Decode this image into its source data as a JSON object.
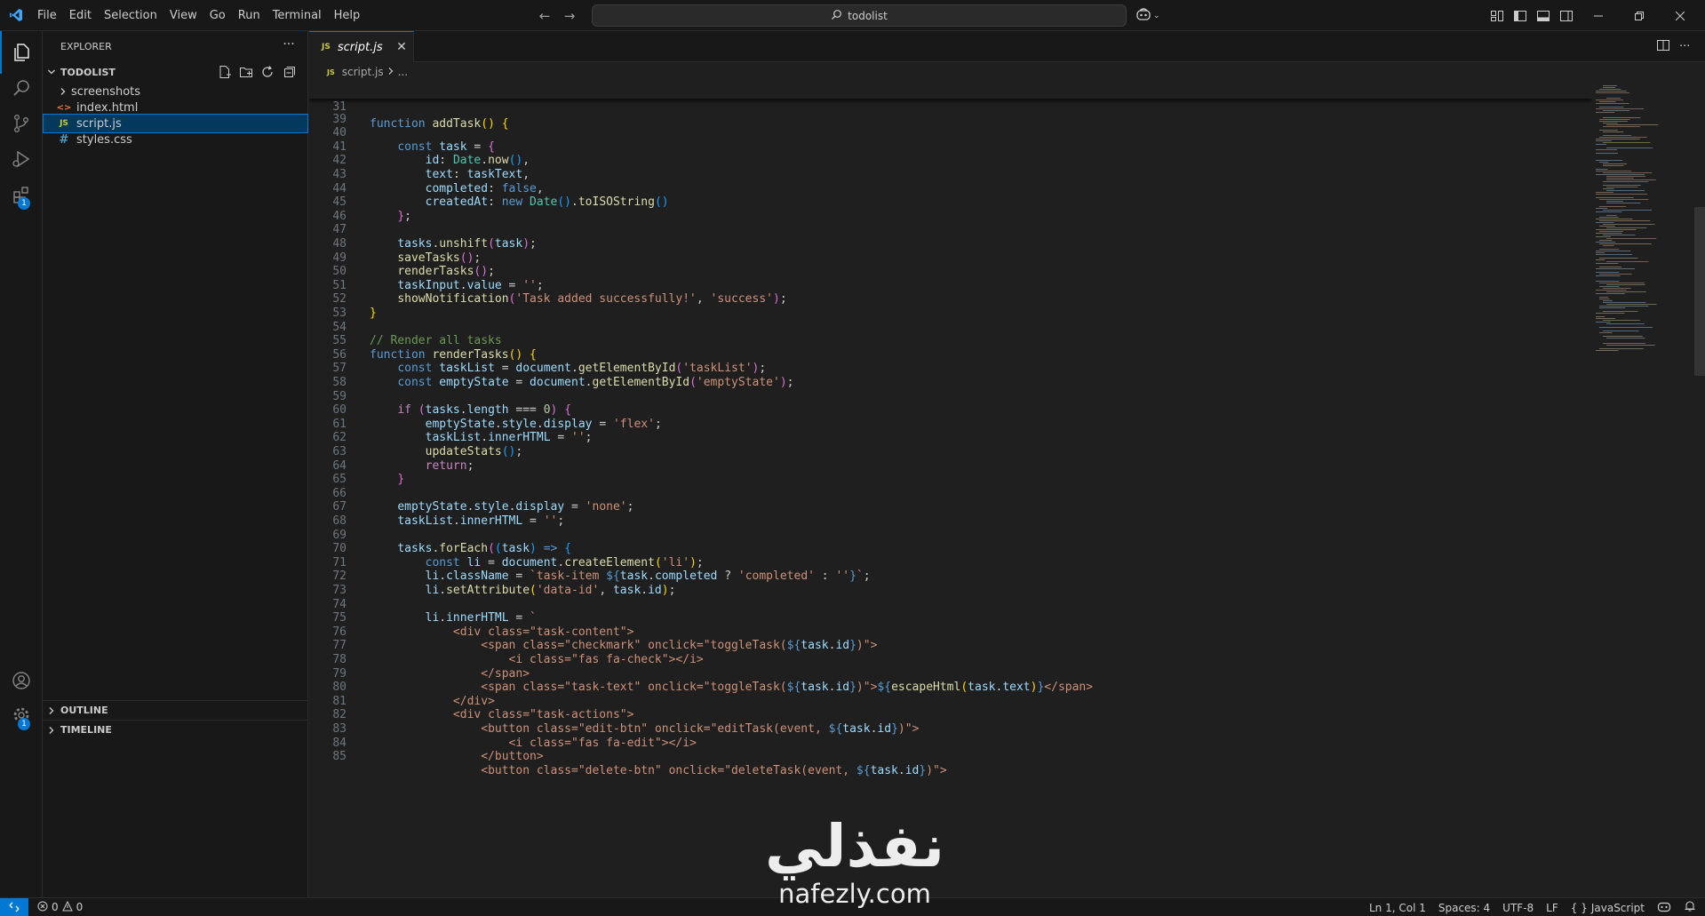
{
  "menu": [
    "File",
    "Edit",
    "Selection",
    "View",
    "Go",
    "Run",
    "Terminal",
    "Help"
  ],
  "command_center": {
    "text": "todolist"
  },
  "sidebar": {
    "title": "EXPLORER",
    "folder": "TODOLIST",
    "items": [
      {
        "name": "screenshots",
        "kind": "folder"
      },
      {
        "name": "index.html",
        "kind": "html"
      },
      {
        "name": "script.js",
        "kind": "js"
      },
      {
        "name": "styles.css",
        "kind": "css"
      }
    ],
    "outline": "OUTLINE",
    "timeline": "TIMELINE"
  },
  "activity": {
    "extensions_badge": "1",
    "settings_badge": "1"
  },
  "tab": {
    "label": "script.js",
    "type": "JS"
  },
  "breadcrumb": {
    "file": "script.js",
    "rest": "..."
  },
  "code": {
    "sticky_line": "31",
    "lines": [
      "39",
      "40",
      "41",
      "42",
      "43",
      "44",
      "45",
      "46",
      "47",
      "48",
      "49",
      "50",
      "51",
      "52",
      "53",
      "54",
      "55",
      "56",
      "57",
      "58",
      "59",
      "60",
      "61",
      "62",
      "63",
      "64",
      "65",
      "66",
      "67",
      "68",
      "69",
      "70",
      "71",
      "72",
      "73",
      "74",
      "75",
      "76",
      "77",
      "78",
      "79",
      "80",
      "81",
      "82",
      "83",
      "84",
      "85"
    ],
    "s": {
      "function": "function",
      "addTask": "addTask",
      "const": "const",
      "task": "task",
      "id": "id",
      "Date": "Date",
      "now": "now",
      "text": "text",
      "taskText": "taskText",
      "completed": "completed",
      "false": "false",
      "createdAt": "createdAt",
      "new": "new",
      "toISOString": "toISOString",
      "tasks": "tasks",
      "unshift": "unshift",
      "saveTasks": "saveTasks",
      "renderTasks": "renderTasks",
      "taskInput": "taskInput",
      "value": "value",
      "empty_str": "''",
      "showNotification": "showNotification",
      "str_added": "'Task added successfully!'",
      "str_success": "'success'",
      "comment_render": "// Render all tasks",
      "taskList": "taskList",
      "document": "document",
      "getElementById": "getElementById",
      "str_taskList": "'taskList'",
      "emptyState": "emptyState",
      "str_emptyState": "'emptyState'",
      "if": "if",
      "length": "length",
      "zero": "0",
      "style": "style",
      "display": "display",
      "str_flex": "'flex'",
      "innerHTML": "innerHTML",
      "updateStats": "updateStats",
      "return": "return",
      "str_none": "'none'",
      "forEach": "forEach",
      "li": "li",
      "createElement": "createElement",
      "str_li": "'li'",
      "className": "className",
      "tpl_taskitem": "`task-item ",
      "str_completed": "'completed'",
      "str_emptytick": "''",
      "setAttribute": "setAttribute",
      "str_dataid": "'data-id'",
      "backtick": "`",
      "div": "div",
      "span": "span",
      "i": "i",
      "button": "button",
      "class_attr": "class",
      "onclick": "onclick",
      "v_task_content": "\"task-content\"",
      "v_checkmark": "\"checkmark\"",
      "v_toggle_pre": "\"toggleTask(",
      "v_fas_check": "\"fas fa-check\"",
      "v_task_text": "\"task-text\"",
      "escapeHtml": "escapeHtml",
      "v_task_actions": "\"task-actions\"",
      "v_edit_btn": "\"edit-btn\"",
      "v_edit_pre": "\"editTask(event, ",
      "v_fas_edit": "\"fas fa-edit\"",
      "v_delete_btn": "\"delete-btn\"",
      "v_delete_pre": "\"deleteTask(event, ",
      "v_close_q": ")\""
    }
  },
  "watermark": {
    "arabic": "نفذلي",
    "latin": "nafezly.com"
  },
  "status": {
    "errors": "0",
    "warnings": "0",
    "position": "Ln 1, Col 1",
    "spaces": "Spaces: 4",
    "encoding": "UTF-8",
    "eol": "LF",
    "language": "JavaScript"
  },
  "colors": {
    "accent": "#0078d4",
    "background": "#1f1f1f",
    "chrome": "#181818"
  }
}
